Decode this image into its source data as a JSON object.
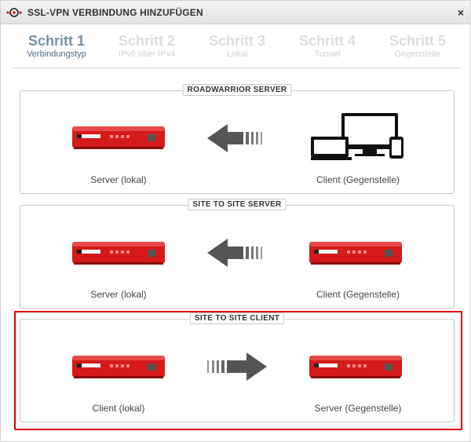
{
  "dialog": {
    "title": "SSL-VPN VERBINDUNG HINZUFÜGEN",
    "close_glyph": "×"
  },
  "steps": [
    {
      "title": "Schritt 1",
      "subtitle": "Verbindungstyp",
      "active": true
    },
    {
      "title": "Schritt 2",
      "subtitle": "IPv6 über IPv4",
      "active": false
    },
    {
      "title": "Schritt 3",
      "subtitle": "Lokal",
      "active": false
    },
    {
      "title": "Schritt 4",
      "subtitle": "Tunnel",
      "active": false
    },
    {
      "title": "Schritt 5",
      "subtitle": "Gegenstelle",
      "active": false
    }
  ],
  "options": [
    {
      "label": "ROADWARRIOR SERVER",
      "left_caption": "Server (lokal)",
      "right_caption": "Client (Gegenstelle)",
      "arrow": "left",
      "right_device": "client-devices",
      "selected": false
    },
    {
      "label": "SITE TO SITE SERVER",
      "left_caption": "Server (lokal)",
      "right_caption": "Client (Gegenstelle)",
      "arrow": "left",
      "right_device": "router",
      "selected": false
    },
    {
      "label": "SITE TO SITE CLIENT",
      "left_caption": "Client (lokal)",
      "right_caption": "Server (Gegenstelle)",
      "arrow": "right",
      "right_device": "router",
      "selected": true
    }
  ],
  "colors": {
    "router_red": "#d41a1a",
    "selection_red": "#e00000",
    "active_step": "#7892a6",
    "inactive_step": "#dcdcdc",
    "arrow_gray": "#555555"
  }
}
